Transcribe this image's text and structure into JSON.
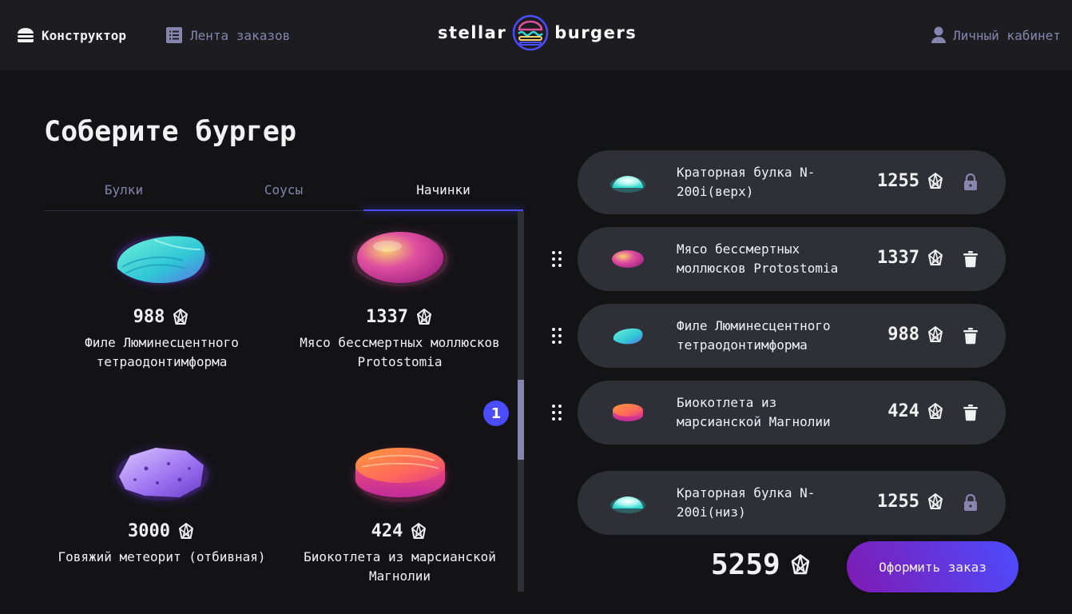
{
  "header": {
    "constructor_label": "Конструктор",
    "feed_label": "Лента заказов",
    "profile_label": "Личный кабинет",
    "logo_left": "stellar",
    "logo_right": "burgers"
  },
  "page": {
    "title": "Соберите бургер"
  },
  "tabs": [
    {
      "label": "Булки",
      "active": false
    },
    {
      "label": "Соусы",
      "active": false
    },
    {
      "label": "Начинки",
      "active": true
    }
  ],
  "ingredients": [
    {
      "price": "988",
      "name": "Филе Люминесцентного тетраодонтимформа",
      "icon": "fish-fillet"
    },
    {
      "price": "1337",
      "name": "Мясо бессмертных моллюсков Protostomia",
      "icon": "mollusk-meat"
    },
    {
      "price": "3000",
      "name": "Говяжий метеорит (отбивная)",
      "icon": "meteorite"
    },
    {
      "price": "424",
      "name": "Биокотлета из марсианской Магнолии",
      "icon": "bio-patty",
      "count": "1"
    }
  ],
  "constructor": {
    "top_bun": {
      "name": "Краторная булка N-200i(верх)",
      "price": "1255"
    },
    "fillings": [
      {
        "name": "Мясо бессмертных моллюсков Protostomia",
        "price": "1337"
      },
      {
        "name": "Филе Люминесцентного тетраодонтимформа",
        "price": "988"
      },
      {
        "name": "Биокотлета из марсианской Магнолии",
        "price": "424"
      }
    ],
    "bottom_bun": {
      "name": "Краторная булка N-200i(низ)",
      "price": "1255"
    }
  },
  "total": {
    "value": "5259"
  },
  "order_button": {
    "label": "Оформить заказ"
  },
  "colors": {
    "accent": "#4c4cff",
    "background": "#131316",
    "card": "#2f2f37",
    "muted": "#8585ad"
  }
}
